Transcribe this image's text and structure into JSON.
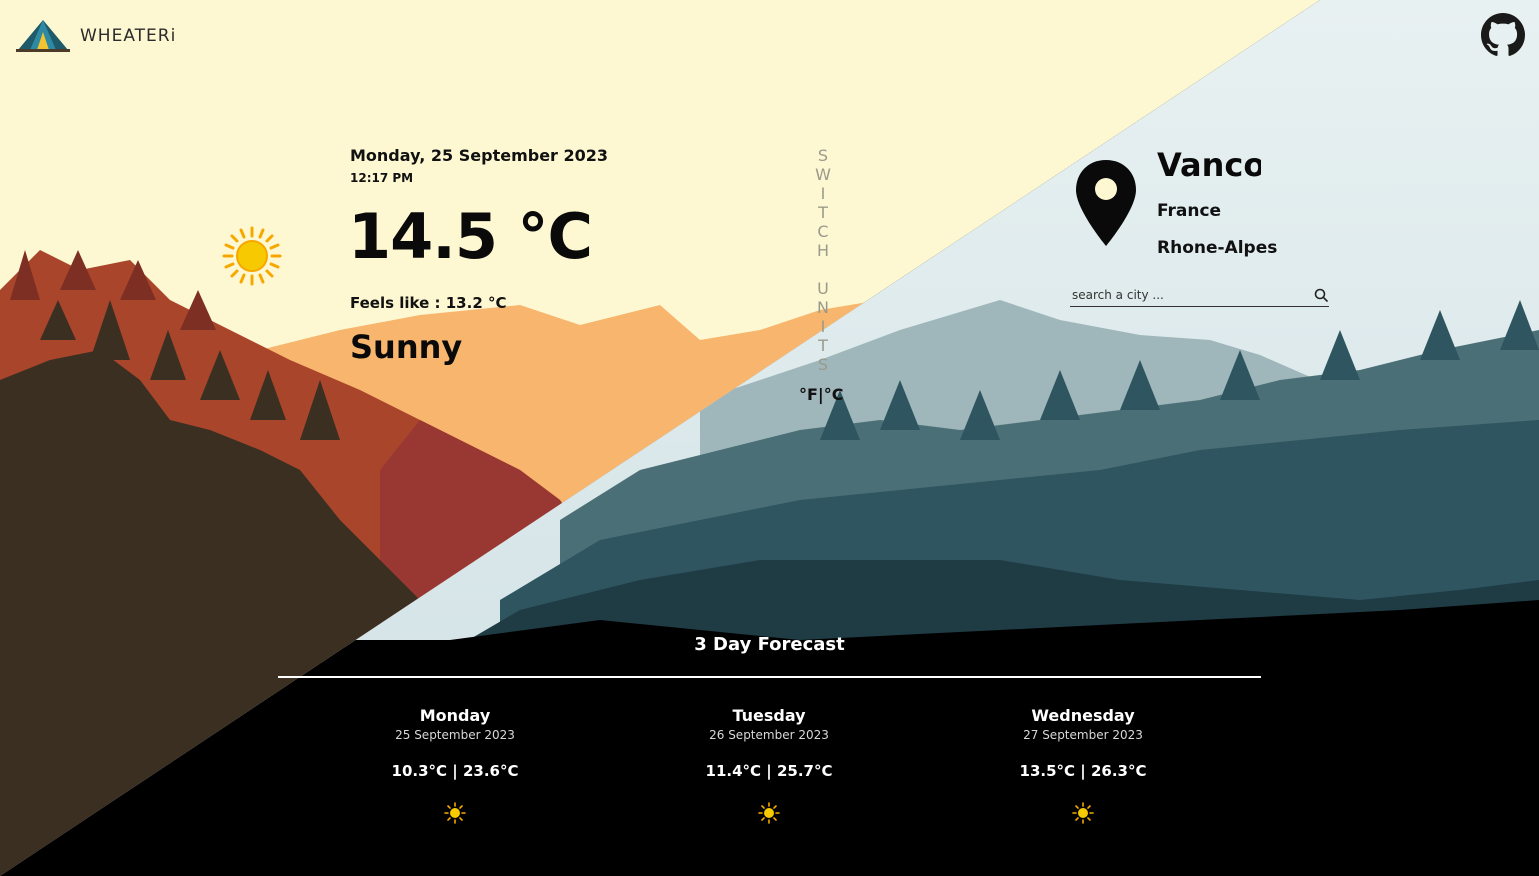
{
  "app": {
    "brand": "WHEATERi"
  },
  "current": {
    "date": "Monday, 25 September 2023",
    "time": "12:17 PM",
    "temperature": "14.5 °C",
    "feels_like": "Feels like : 13.2 °C",
    "condition": "Sunny",
    "icon": "sun-icon"
  },
  "units_switch": {
    "letters": [
      "S",
      "W",
      "I",
      "T",
      "C",
      "H",
      "",
      "U",
      "N",
      "I",
      "T",
      "S"
    ],
    "toggle_label": "°F|°C"
  },
  "location": {
    "city": "Vancouver",
    "country": "France",
    "region": "Rhone-Alpes",
    "icon": "map-pin-icon"
  },
  "search": {
    "placeholder": "search a city ..."
  },
  "forecast": {
    "title": "3 Day Forecast",
    "days": [
      {
        "name": "Monday",
        "date": "25 September 2023",
        "range": "10.3°C | 23.6°C",
        "icon": "sun-icon"
      },
      {
        "name": "Tuesday",
        "date": "26 September 2023",
        "range": "11.4°C | 25.7°C",
        "icon": "sun-icon"
      },
      {
        "name": "Wednesday",
        "date": "27 September 2023",
        "range": "13.5°C | 26.3°C",
        "icon": "sun-icon"
      }
    ]
  },
  "colors": {
    "sky_warm": "#fdf8d2",
    "sky_cool": "#e3eef0",
    "mountain_warm": "#f8b56e",
    "forest_red": "#a9452b",
    "forest_dark": "#3b2f22",
    "forest_teal": "#2e5560",
    "sun_yellow": "#f7c900"
  }
}
